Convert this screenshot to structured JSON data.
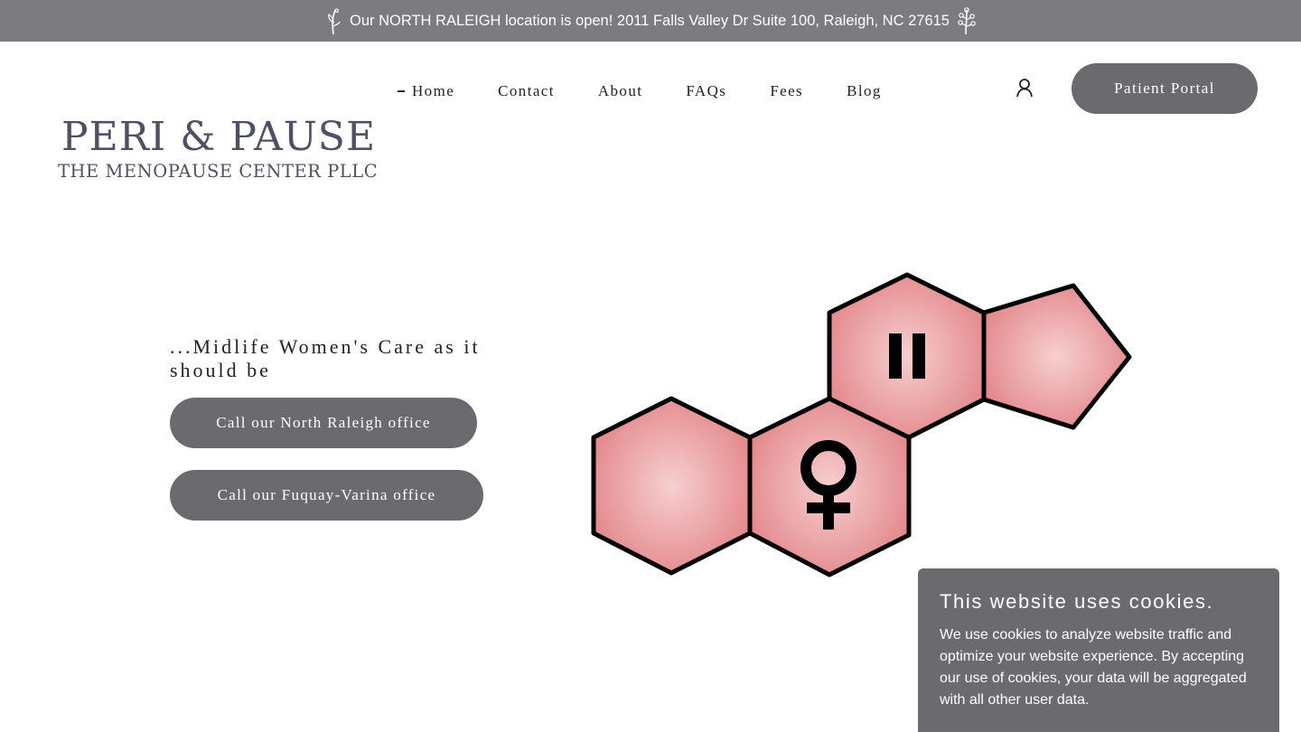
{
  "announcement": {
    "text": "Our NORTH RALEIGH location is open! 2011 Falls Valley Dr Suite 100, Raleigh, NC 27615",
    "icon_left": "sprig-icon",
    "icon_right": "flower-sprig-icon"
  },
  "logo": {
    "line1": "PERI & PAUSE",
    "line2": "THE MENOPAUSE CENTER PLLC"
  },
  "nav": {
    "items": [
      {
        "label": "Home",
        "active": true
      },
      {
        "label": "Contact"
      },
      {
        "label": "About"
      },
      {
        "label": "FAQs"
      },
      {
        "label": "Fees"
      },
      {
        "label": "Blog"
      }
    ],
    "account_icon": "user-icon"
  },
  "header": {
    "portal_label": "Patient Portal"
  },
  "hero": {
    "tagline": "...Midlife Women's Care as it should be",
    "call_north_label": "Call our North Raleigh office",
    "call_fuquay_label": "Call our Fuquay-Varina office",
    "graphic": "hormone-molecule-illustration"
  },
  "cookie_banner": {
    "title": "This website uses cookies.",
    "body": "We use cookies to analyze website traffic and optimize your website experience. By accepting our use of cookies, your data will be aggregated with all other user data."
  },
  "colors": {
    "announcement_bg": "#7c7b7f",
    "button_bg": "#6b6a6f",
    "logo_text": "#4e5064",
    "hex_fill": "#e79a9c",
    "hex_center": "#f7cfd0"
  }
}
